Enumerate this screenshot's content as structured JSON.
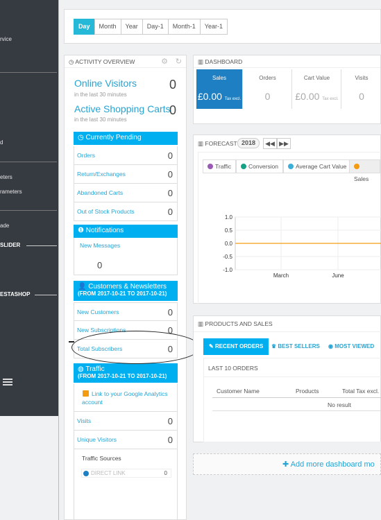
{
  "sidebar": {
    "items": [
      "rvice",
      "d",
      "eters",
      "rameters",
      "ade"
    ],
    "slider": "SLIDER",
    "prestashop": "ESTASHOP"
  },
  "datebar": {
    "buttons": [
      "Day",
      "Month",
      "Year",
      "Day-1",
      "Month-1",
      "Year-1"
    ]
  },
  "activity": {
    "title": "ACTIVITY OVERVIEW",
    "online_label": "Online Visitors",
    "online_sub": "in the last 30 minutes",
    "online_value": "0",
    "carts_label": "Active Shopping Carts",
    "carts_sub": "in the last 30 minutes",
    "carts_value": "0",
    "pending_title": "Currently Pending",
    "pending": [
      {
        "label": "Orders",
        "value": "0"
      },
      {
        "label": "Return/Exchanges",
        "value": "0"
      },
      {
        "label": "Abandoned Carts",
        "value": "0"
      },
      {
        "label": "Out of Stock Products",
        "value": "0"
      }
    ],
    "notif_title": "Notifications",
    "notif_label": "New Messages",
    "notif_value": "0",
    "cust_title": "Customers & Newsletters",
    "cust_range": "(FROM 2017-10-21 TO 2017-10-21)",
    "cust": [
      {
        "label": "New Customers",
        "value": "0"
      },
      {
        "label": "New Subscriptions",
        "value": "0"
      },
      {
        "label": "Total Subscribers",
        "value": "0"
      }
    ],
    "traffic_title": "Traffic",
    "traffic_range": "(FROM 2017-10-21 TO 2017-10-21)",
    "ga_link": "Link to your Google Analytics account",
    "traffic": [
      {
        "label": "Visits",
        "value": "0"
      },
      {
        "label": "Unique Visitors",
        "value": "0"
      }
    ],
    "sources_title": "Traffic Sources",
    "direct_link": "DIRECT LINK",
    "direct_value": "0"
  },
  "dashboard": {
    "title": "DASHBOARD",
    "kpis": [
      {
        "label": "Sales",
        "value": "£0.00",
        "suffix": "Tax excl."
      },
      {
        "label": "Orders",
        "value": "0",
        "suffix": ""
      },
      {
        "label": "Cart Value",
        "value": "£0.00",
        "suffix": "Tax excl."
      },
      {
        "label": "Visits",
        "value": "0",
        "suffix": ""
      }
    ]
  },
  "forecast": {
    "title": "FORECAST",
    "year": "2018",
    "tabs": [
      {
        "label": "Traffic",
        "color": "#9b59b6"
      },
      {
        "label": "Conversion",
        "color": "#16a085"
      },
      {
        "label": "Average Cart Value",
        "color": "#3bafda"
      },
      {
        "label": "Sales",
        "color": "#f39c12"
      }
    ]
  },
  "chart_data": {
    "type": "line",
    "x_ticks": [
      "March",
      "June"
    ],
    "y_ticks": [
      "1.0",
      "0.5",
      "0.0",
      "-0.5",
      "-1.0"
    ],
    "ylim": [
      -1.0,
      1.0
    ],
    "series": [
      {
        "name": "Sales",
        "color": "#f39c12",
        "values": [
          0,
          0,
          0,
          0,
          0,
          0
        ]
      }
    ]
  },
  "products": {
    "title": "PRODUCTS AND SALES",
    "tabs": [
      "RECENT ORDERS",
      "BEST SELLERS",
      "MOST VIEWED"
    ],
    "last_orders": "LAST 10 ORDERS",
    "columns": [
      "Customer Name",
      "Products",
      "Total Tax excl."
    ],
    "empty": "No result"
  },
  "add_more": "Add more dashboard mo"
}
